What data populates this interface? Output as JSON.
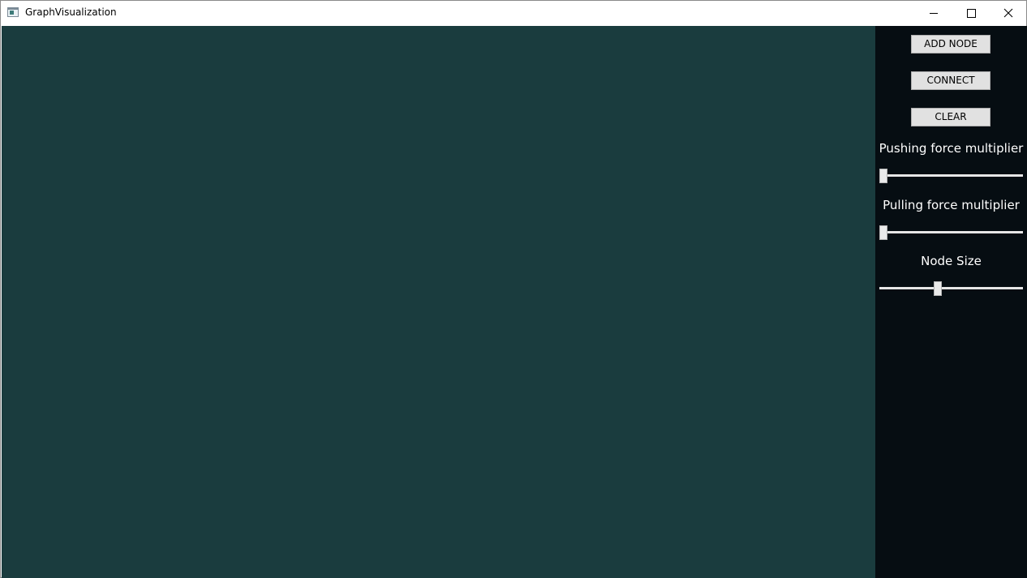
{
  "window": {
    "title": "GraphVisualization"
  },
  "colors": {
    "canvas_bg": "#1a3c3e",
    "panel_bg": "#060d12",
    "button_bg": "#e1e1e1",
    "label_color": "#ffffff"
  },
  "controls": {
    "add_node_label": "ADD NODE",
    "connect_label": "CONNECT",
    "clear_label": "CLEAR"
  },
  "sliders": {
    "pushing": {
      "label": "Pushing force multiplier",
      "value_fraction": 0.0
    },
    "pulling": {
      "label": "Pulling force multiplier",
      "value_fraction": 0.0
    },
    "node_size": {
      "label": "Node Size",
      "value_fraction": 0.4
    }
  }
}
